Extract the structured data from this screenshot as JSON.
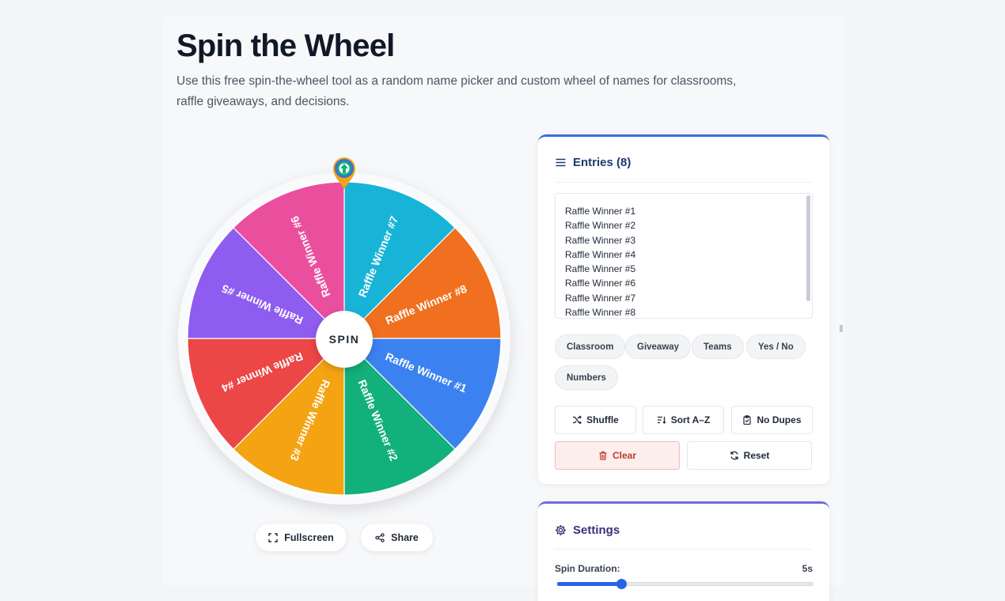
{
  "header": {
    "title": "Spin the Wheel",
    "subtitle": "Use this free spin-the-wheel tool as a random name picker and custom wheel of names for classrooms, raffle giveaways, and decisions."
  },
  "wheel": {
    "spin_label": "SPIN",
    "segments": [
      {
        "label": "Raffle Winner #7",
        "color": "#18b4d8"
      },
      {
        "label": "Raffle Winner #8",
        "color": "#f07020"
      },
      {
        "label": "Raffle Winner #1",
        "color": "#3b82f0"
      },
      {
        "label": "Raffle Winner #2",
        "color": "#12b07a"
      },
      {
        "label": "Raffle Winner #3",
        "color": "#f4a412"
      },
      {
        "label": "Raffle Winner #4",
        "color": "#ec4646"
      },
      {
        "label": "Raffle Winner #5",
        "color": "#8f5cf0"
      },
      {
        "label": "Raffle Winner #6",
        "color": "#ea4f9e"
      }
    ],
    "fullscreen_label": "Fullscreen",
    "share_label": "Share"
  },
  "entries": {
    "title": "Entries (8)",
    "items": [
      "Raffle Winner #1",
      "Raffle Winner #2",
      "Raffle Winner #3",
      "Raffle Winner #4",
      "Raffle Winner #5",
      "Raffle Winner #6",
      "Raffle Winner #7",
      "Raffle Winner #8"
    ],
    "presets": [
      "Classroom",
      "Giveaway",
      "Teams",
      "Yes / No",
      "Numbers"
    ],
    "actions": {
      "shuffle": "Shuffle",
      "sort": "Sort A–Z",
      "no_dupes": "No Dupes",
      "clear": "Clear",
      "reset": "Reset"
    }
  },
  "settings": {
    "title": "Settings",
    "spin_duration_label": "Spin Duration:",
    "spin_duration_value": "5s",
    "spin_duration_fraction": 0.25
  },
  "colors": {
    "accent": "#2563eb",
    "entries_border": "#3b6fd8",
    "settings_border": "#6f6bd8",
    "clear_text": "#c0392b"
  }
}
